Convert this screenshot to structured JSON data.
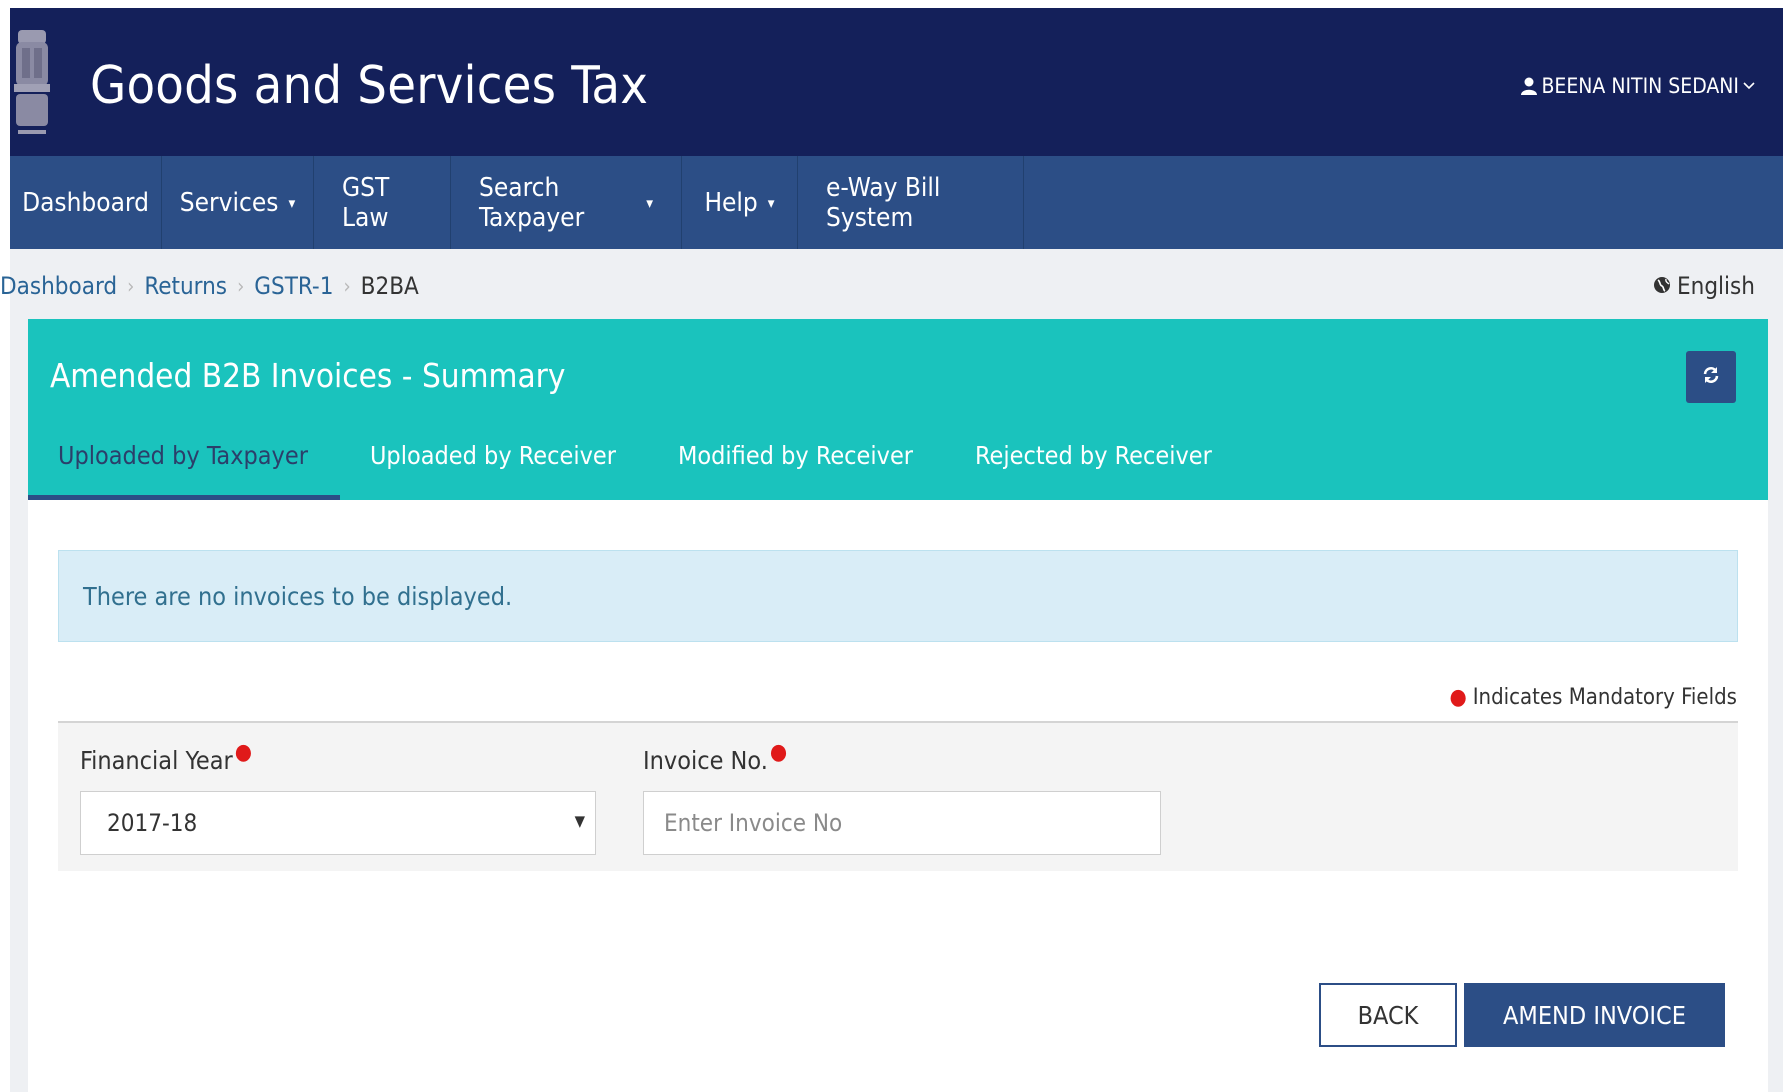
{
  "header": {
    "title": "Goods and Services Tax",
    "user_name": "BEENA NITIN SEDANI"
  },
  "nav": [
    {
      "label": "Dashboard",
      "dropdown": false
    },
    {
      "label": "Services",
      "dropdown": true
    },
    {
      "label": "GST Law",
      "dropdown": false
    },
    {
      "label": "Search Taxpayer",
      "dropdown": true
    },
    {
      "label": "Help",
      "dropdown": true
    },
    {
      "label": "e-Way Bill System",
      "dropdown": false
    }
  ],
  "breadcrumb": {
    "items": [
      "Dashboard",
      "Returns",
      "GSTR-1"
    ],
    "current": "B2BA"
  },
  "language": "English",
  "card": {
    "title": "Amended B2B Invoices - Summary",
    "tabs": [
      "Uploaded by Taxpayer",
      "Uploaded by Receiver",
      "Modified by Receiver",
      "Rejected by Receiver"
    ],
    "active_tab": 0
  },
  "alert": "There are no invoices to be displayed.",
  "mandatory_note": "Indicates Mandatory Fields",
  "form": {
    "financial_year_label": "Financial Year",
    "financial_year_value": "2017-18",
    "invoice_label": "Invoice No.",
    "invoice_placeholder": "Enter Invoice No",
    "invoice_value": ""
  },
  "buttons": {
    "back": "BACK",
    "amend": "AMEND INVOICE"
  },
  "colors": {
    "header_bg": "#14205a",
    "navbar_bg": "#2c4e86",
    "card_head_bg": "#1ac3bd",
    "alert_bg": "#d9edf7",
    "primary_button": "#2c4e86",
    "mandatory_dot": "#e01a1a"
  },
  "icons": {
    "emblem": "national-emblem-icon",
    "user": "user-icon",
    "user_caret": "chevron-down-icon",
    "language": "globe-icon",
    "refresh": "refresh-icon",
    "select_arrow": "triangle-down-icon"
  }
}
